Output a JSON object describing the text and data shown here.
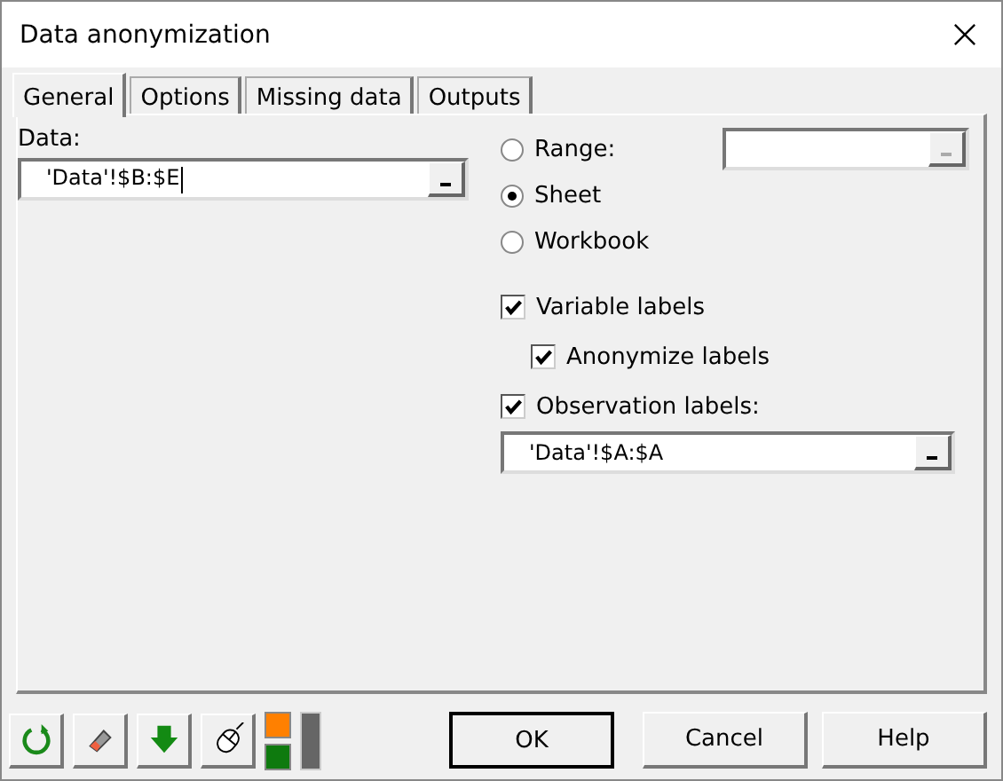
{
  "window": {
    "title": "Data anonymization"
  },
  "tabs": [
    {
      "label": "General",
      "selected": true
    },
    {
      "label": "Options",
      "selected": false
    },
    {
      "label": "Missing data",
      "selected": false
    },
    {
      "label": "Outputs",
      "selected": false
    }
  ],
  "data_field": {
    "label": "Data:",
    "value": "'Data'!$B:$E"
  },
  "scope": [
    {
      "label": "Range:",
      "selected": false
    },
    {
      "label": "Sheet",
      "selected": true
    },
    {
      "label": "Workbook",
      "selected": false
    }
  ],
  "range_field": {
    "button_disabled": true
  },
  "checks": [
    {
      "label": "Variable labels",
      "checked": true,
      "children": [
        {
          "label": "Anonymize labels",
          "checked": true
        }
      ]
    },
    {
      "label": "Observation labels:",
      "checked": true
    }
  ],
  "observation_field": {
    "value": "'Data'!$A:$A"
  },
  "buttons": [
    {
      "label": "OK",
      "default": true
    },
    {
      "label": "Cancel",
      "default": false
    },
    {
      "label": "Help",
      "default": false
    }
  ]
}
